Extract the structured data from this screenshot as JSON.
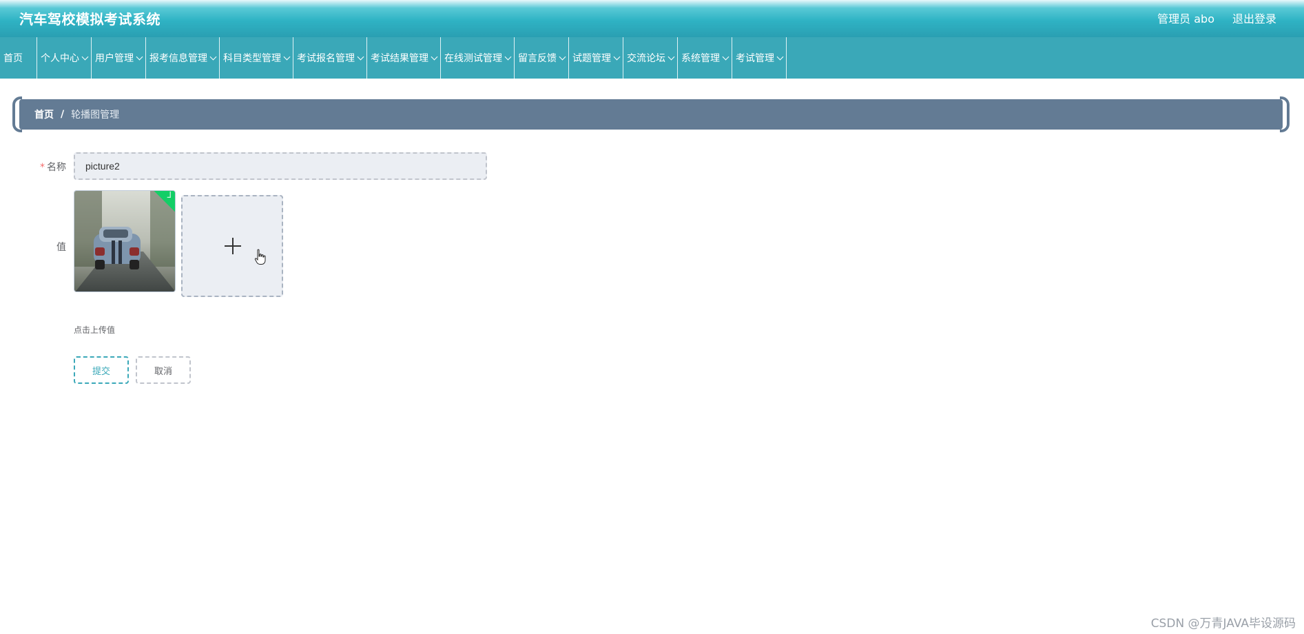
{
  "header": {
    "title": "汽车驾校模拟考试系统",
    "user": "管理员 abo",
    "logout": "退出登录"
  },
  "nav": {
    "items": [
      {
        "label": "首页",
        "dropdown": false
      },
      {
        "label": "个人中心",
        "dropdown": true
      },
      {
        "label": "用户管理",
        "dropdown": true
      },
      {
        "label": "报考信息管理",
        "dropdown": true
      },
      {
        "label": "科目类型管理",
        "dropdown": true
      },
      {
        "label": "考试报名管理",
        "dropdown": true
      },
      {
        "label": "考试结果管理",
        "dropdown": true
      },
      {
        "label": "在线测试管理",
        "dropdown": true
      },
      {
        "label": "留言反馈",
        "dropdown": true
      },
      {
        "label": "试题管理",
        "dropdown": true
      },
      {
        "label": "交流论坛",
        "dropdown": true
      },
      {
        "label": "系统管理",
        "dropdown": true
      },
      {
        "label": "考试管理",
        "dropdown": true
      }
    ]
  },
  "breadcrumb": {
    "home": "首页",
    "separator": "/",
    "current": "轮播图管理"
  },
  "form": {
    "required_mark": "*",
    "name_label": "名称",
    "name_value": "picture2",
    "value_label": "值",
    "upload_tip": "点击上传值",
    "submit_label": "提交",
    "cancel_label": "取消"
  },
  "watermark": "CSDN @万青JAVA毕设源码",
  "colors": {
    "nav_bg": "#3aa8b8",
    "breadcrumb_bg": "#637b94",
    "success": "#13ce66"
  },
  "icons": {
    "nav_dropdown": "chevron-down-icon",
    "upload": "plus-icon",
    "uploaded": "check-icon"
  }
}
